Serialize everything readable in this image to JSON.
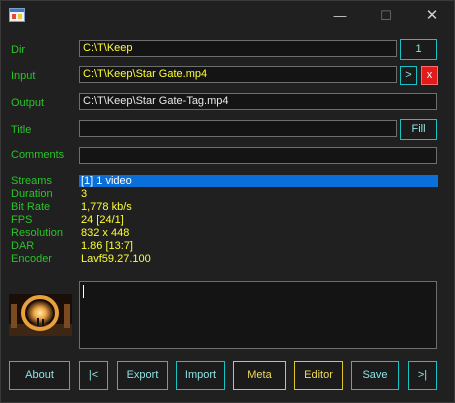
{
  "window": {
    "minimize": "—",
    "maximize": "☐",
    "close": "✕"
  },
  "labels": {
    "dir": "Dir",
    "input": "Input",
    "output": "Output",
    "title": "Title",
    "comments": "Comments"
  },
  "fields": {
    "dir": "C:\\T\\Keep",
    "input": "C:\\T\\Keep\\Star Gate.mp4",
    "output": "C:\\T\\Keep\\Star Gate-Tag.mp4",
    "title": "",
    "comments": ""
  },
  "side_buttons": {
    "dir_number": "1",
    "next": ">",
    "remove": "x",
    "fill": "Fill"
  },
  "info": [
    {
      "key": "Streams",
      "value": "[1]  1 video",
      "selected": true
    },
    {
      "key": "Duration",
      "value": "3"
    },
    {
      "key": "Bit Rate",
      "value": "1,778 kb/s"
    },
    {
      "key": "FPS",
      "value": "24  [24/1]"
    },
    {
      "key": "Resolution",
      "value": "832 x 448"
    },
    {
      "key": "DAR",
      "value": "1.86  [13:7]"
    },
    {
      "key": "Encoder",
      "value": "Lavf59.27.100"
    }
  ],
  "bottom_buttons": {
    "about": "About",
    "first": "|<",
    "export": "Export",
    "import": "Import",
    "meta": "Meta",
    "editor": "Editor",
    "save": "Save",
    "last": ">|"
  },
  "colors": {
    "label_green": "#27c427",
    "value_yellow": "#ffff33",
    "button_cyan": "#19c2c2",
    "button_gold": "#e2c22d",
    "selection_blue": "#0a6fd9",
    "remove_red": "#e01b1b"
  }
}
